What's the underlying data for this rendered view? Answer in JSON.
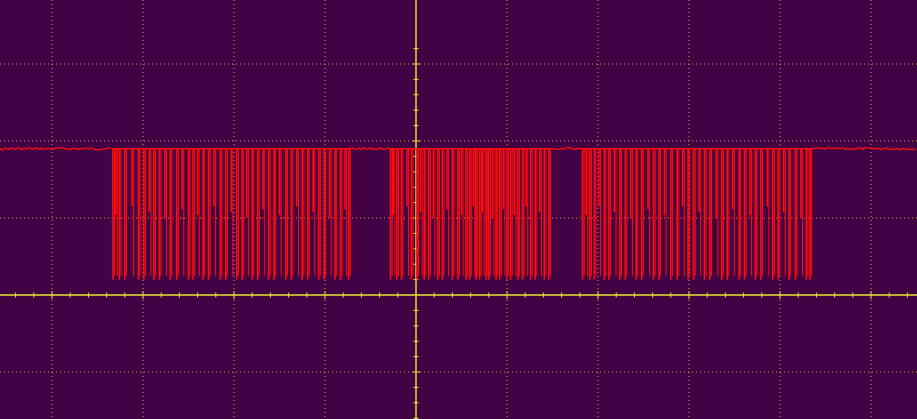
{
  "screen": {
    "background": "#420243",
    "grid_color": "#c8c84a",
    "axis_color": "#e6e632",
    "trace_color": "#ff0d0d"
  },
  "chart_data": {
    "type": "line",
    "title": "",
    "xlabel": "",
    "ylabel": "",
    "grid": true,
    "grid_style": "dotted",
    "horizontal_divisions": 10,
    "vertical_divisions": 6,
    "xlim": [
      -5,
      5.5
    ],
    "ylim": [
      -1.75,
      3.25
    ],
    "baseline_level": 1.9,
    "low_level": 0.2,
    "mid_level": 1.0,
    "trace_segment": "pulse-train",
    "series": [
      {
        "bursts": [
          {
            "start": -3.35,
            "end": -0.72,
            "pulses": [
              -3.33,
              -3.3,
              -3.26,
              -3.2,
              -3.12,
              -3.05,
              -2.99,
              -2.93,
              -2.88,
              -2.82,
              -2.76,
              -2.7,
              -2.63,
              -2.57,
              -2.5,
              -2.45,
              -2.4,
              -2.34,
              -2.28,
              -2.22,
              -2.15,
              -2.09,
              -2.03,
              -1.97,
              -1.91,
              -1.86,
              -1.8,
              -1.74,
              -1.68,
              -1.62,
              -1.56,
              -1.5,
              -1.43,
              -1.37,
              -1.31,
              -1.25,
              -1.19,
              -1.13,
              -1.07,
              -1.01,
              -0.95,
              -0.89,
              -0.83,
              -0.78,
              -0.74
            ]
          },
          {
            "start": -0.3,
            "end": 1.5,
            "pulses": [
              -0.28,
              -0.25,
              -0.21,
              -0.16,
              -0.1,
              -0.05,
              0.01,
              0.05,
              0.09,
              0.14,
              0.19,
              0.24,
              0.29,
              0.34,
              0.4,
              0.46,
              0.5,
              0.55,
              0.59,
              0.63,
              0.66,
              0.7,
              0.73,
              0.77,
              0.8,
              0.84,
              0.88,
              0.92,
              0.96,
              1.0,
              1.04,
              1.08,
              1.12,
              1.17,
              1.21,
              1.26,
              1.31,
              1.36,
              1.41,
              1.46
            ]
          },
          {
            "start": 1.8,
            "end": 4.35,
            "pulses": [
              1.83,
              1.87,
              1.91,
              1.96,
              2.01,
              2.07,
              2.12,
              2.18,
              2.24,
              2.3,
              2.36,
              2.42,
              2.48,
              2.55,
              2.61,
              2.67,
              2.73,
              2.8,
              2.87,
              2.93,
              2.99,
              3.05,
              3.11,
              3.17,
              3.23,
              3.3,
              3.36,
              3.42,
              3.48,
              3.55,
              3.61,
              3.67,
              3.73,
              3.79,
              3.86,
              3.92,
              3.98,
              4.04,
              4.1,
              4.17,
              4.23,
              4.29,
              4.33
            ]
          }
        ]
      }
    ]
  }
}
